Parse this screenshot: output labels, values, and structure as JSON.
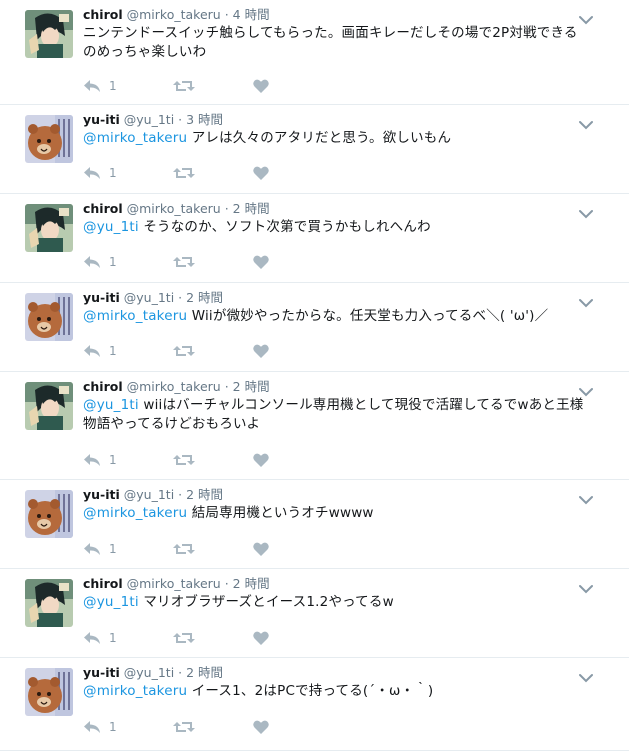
{
  "tweets": [
    {
      "name": "chirol",
      "handle": "@mirko_takeru",
      "time": "4 時間",
      "mention": "",
      "text": "ニンテンドースイッチ触らしてもらった。画面キレーだしその場で2P対戦できるのめっちゃ楽しいわ",
      "replies": "1",
      "user": "chirol"
    },
    {
      "name": "yu-iti",
      "handle": "@yu_1ti",
      "time": "3 時間",
      "mention": "@mirko_takeru",
      "text": " アレは久々のアタリだと思う。欲しいもん",
      "replies": "1",
      "user": "yu-iti"
    },
    {
      "name": "chirol",
      "handle": "@mirko_takeru",
      "time": "2 時間",
      "mention": "@yu_1ti",
      "text": " そうなのか、ソフト次第で買うかもしれへんわ",
      "replies": "1",
      "user": "chirol"
    },
    {
      "name": "yu-iti",
      "handle": "@yu_1ti",
      "time": "2 時間",
      "mention": "@mirko_takeru",
      "text": " Wiiが微妙やったからな。任天堂も力入ってるべ＼( 'ω')／",
      "replies": "1",
      "user": "yu-iti"
    },
    {
      "name": "chirol",
      "handle": "@mirko_takeru",
      "time": "2 時間",
      "mention": "@yu_1ti",
      "text": " wiiはバーチャルコンソール専用機として現役で活躍してるでwあと王様物語やってるけどおもろいよ",
      "replies": "1",
      "user": "chirol"
    },
    {
      "name": "yu-iti",
      "handle": "@yu_1ti",
      "time": "2 時間",
      "mention": "@mirko_takeru",
      "text": " 結局専用機というオチwwww",
      "replies": "1",
      "user": "yu-iti"
    },
    {
      "name": "chirol",
      "handle": "@mirko_takeru",
      "time": "2 時間",
      "mention": "@yu_1ti",
      "text": " マリオブラザーズとイース1.2やってるw",
      "replies": "1",
      "user": "chirol"
    },
    {
      "name": "yu-iti",
      "handle": "@yu_1ti",
      "time": "2 時間",
      "mention": "@mirko_takeru",
      "text": " イース1、2はPCで持ってる(´・ω・｀)",
      "replies": "1",
      "user": "yu-iti"
    }
  ],
  "separator": " · ",
  "icons": {
    "reply": "reply-icon",
    "retweet": "retweet-icon",
    "like": "heart-icon",
    "more": "chevron-down-icon"
  },
  "colors": {
    "mention": "#1b95e0",
    "muted": "#657786",
    "action": "#aab8c2",
    "border": "#e6ecf0"
  }
}
